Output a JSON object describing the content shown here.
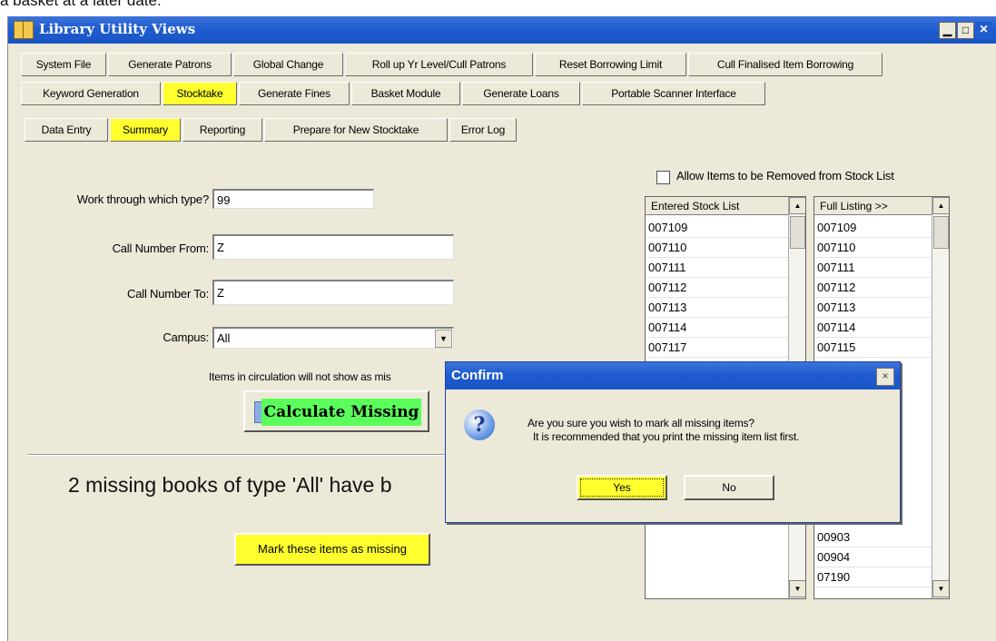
{
  "top_caption": "a basket at a later date.",
  "window": {
    "title": "Library Utility Views"
  },
  "tabs_row1": [
    "System File",
    "Generate Patrons",
    "Global Change",
    "Roll up Yr Level/Cull Patrons",
    "Reset Borrowing Limit",
    "Cull Finalised Item Borrowing"
  ],
  "tabs_row2": [
    "Keyword Generation",
    "Stocktake",
    "Generate Fines",
    "Basket Module",
    "Generate Loans",
    "Portable Scanner Interface"
  ],
  "tabs_row3": [
    "Data Entry",
    "Summary",
    "Reporting",
    "Prepare for New Stocktake",
    "Error Log"
  ],
  "form": {
    "type_label": "Work through which type?",
    "type_value": "99",
    "call_from_label": "Call Number From:",
    "call_from_value": "Z",
    "call_to_label": "Call Number To:",
    "call_to_value": "Z",
    "campus_label": "Campus:",
    "campus_value": "All",
    "note": "Items in circulation will not show as mis",
    "calculate_label": "Calculate Missing",
    "result_text": "2 missing books of type 'All' have b",
    "mark_label": "Mark these items as missing"
  },
  "allow_remove_label": "Allow Items to be Removed from Stock List",
  "entered_list": {
    "header": "Entered Stock List",
    "items": [
      "007109",
      "007110",
      "007111",
      "007112",
      "007113",
      "007114",
      "007117"
    ]
  },
  "full_list": {
    "header": "Full Listing >>",
    "items": [
      "007109",
      "007110",
      "007111",
      "007112",
      "007113",
      "007114",
      "007115"
    ],
    "bottom_items": [
      "00903",
      "00904",
      "07190"
    ]
  },
  "dialog": {
    "title": "Confirm",
    "line1": "Are you sure you wish to mark all missing items?",
    "line2": "It is recommended that you print the missing item list first.",
    "yes": "Yes",
    "no": "No"
  },
  "colors": {
    "highlight": "#ffff2d",
    "calc_button": "#5bff5b",
    "titlebar": "#1f5ccf"
  }
}
